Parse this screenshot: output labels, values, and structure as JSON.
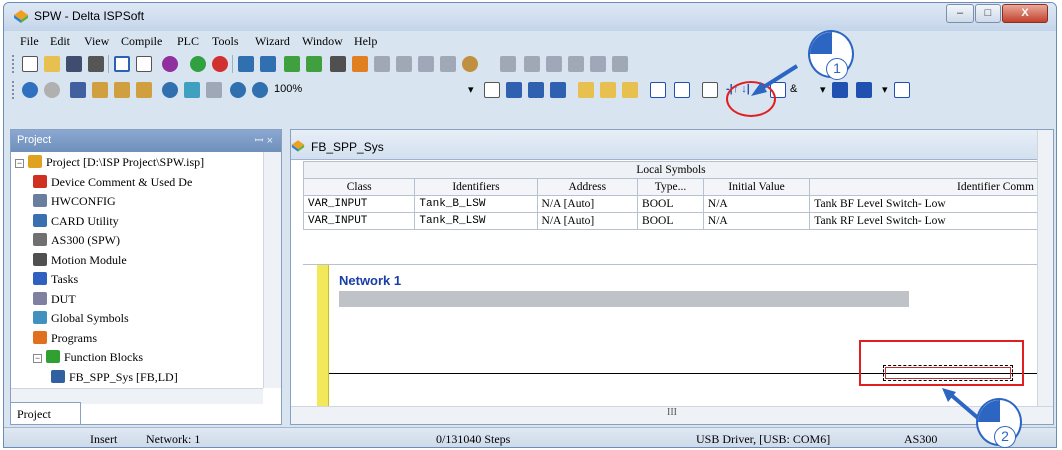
{
  "window": {
    "title": "SPW - Delta ISPSoft",
    "minimize": "–",
    "maximize": "□",
    "close": "X"
  },
  "menu": [
    "File",
    "Edit",
    "View",
    "Compile",
    "PLC",
    "Tools",
    "Wizard",
    "Window",
    "Help"
  ],
  "toolbar": {
    "zoom": "100%",
    "contact_label": "-|↑ ↓|",
    "and_label": "&"
  },
  "project_panel": {
    "title": "Project",
    "pin": "ꟷ ×",
    "tree": [
      {
        "label": "Project [D:\\ISP Project\\SPW.isp]",
        "icon": "project-icon",
        "color": "#e0a020"
      },
      {
        "label": "Device Comment & Used De",
        "icon": "device-comment-icon",
        "color": "#d03020"
      },
      {
        "label": "HWCONFIG",
        "icon": "hwconfig-icon",
        "color": "#6a7fa0"
      },
      {
        "label": "CARD Utility",
        "icon": "card-utility-icon",
        "color": "#3a70b0"
      },
      {
        "label": "AS300  (SPW)",
        "icon": "plc-icon",
        "color": "#707070"
      },
      {
        "label": "Motion Module",
        "icon": "motion-module-icon",
        "color": "#505050"
      },
      {
        "label": "Tasks",
        "icon": "tasks-icon",
        "color": "#3060c0"
      },
      {
        "label": "DUT",
        "icon": "dut-icon",
        "color": "#8080a0"
      },
      {
        "label": "Global Symbols",
        "icon": "global-symbols-icon",
        "color": "#4090c0"
      },
      {
        "label": "Programs",
        "icon": "programs-icon",
        "color": "#e07020"
      },
      {
        "label": "Function Blocks",
        "icon": "function-blocks-icon",
        "color": "#30a030"
      },
      {
        "label": "FB_SPP_Sys [FB,LD]",
        "icon": "fb-icon",
        "color": "#3060a0"
      }
    ],
    "tab": "Project"
  },
  "editor": {
    "tab": "FB_SPP_Sys",
    "table_caption": "Local Symbols",
    "columns": [
      "Class",
      "Identifiers",
      "Address",
      "Type...",
      "Initial Value",
      "Identifier Comm"
    ],
    "rows": [
      [
        "VAR_INPUT",
        "Tank_B_LSW",
        "N/A [Auto]",
        "BOOL",
        "N/A",
        "Tank BF Level Switch- Low"
      ],
      [
        "VAR_INPUT",
        "Tank_R_LSW",
        "N/A [Auto]",
        "BOOL",
        "N/A",
        "Tank RF Level Switch- Low"
      ]
    ],
    "network_title": "Network 1",
    "scroll_marker": "III"
  },
  "status": {
    "mode": "Insert",
    "network": "Network: 1",
    "steps": "0/131040 Steps",
    "driver": "USB Driver, [USB: COM6]",
    "plc": "AS300"
  },
  "annotations": {
    "step1": "1",
    "step2": "2"
  }
}
